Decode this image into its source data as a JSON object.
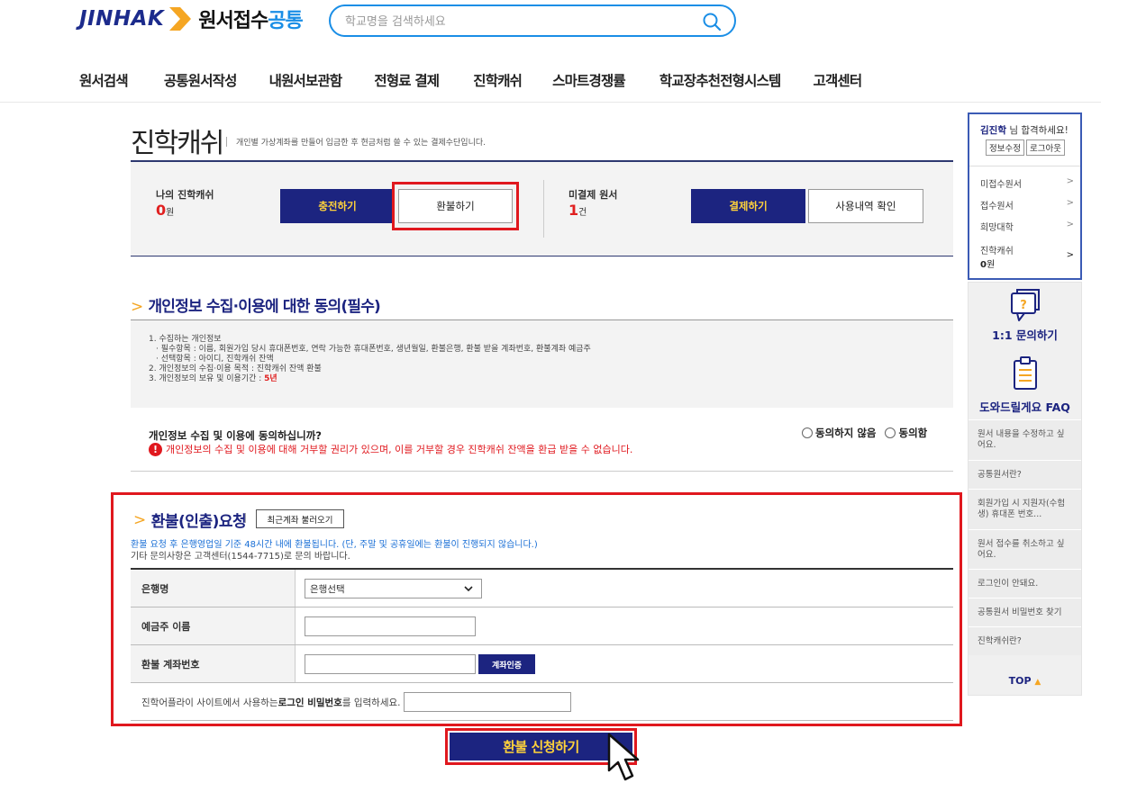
{
  "header": {
    "logo_text": "JINHAK",
    "site_title_main": "원서접수",
    "site_title_accent": "공통",
    "search_placeholder": "학교명을 검색하세요"
  },
  "nav": [
    "원서검색",
    "공통원서작성",
    "내원서보관함",
    "전형료 결제",
    "진학캐쉬",
    "스마트경쟁률",
    "학교장추천전형시스템",
    "고객센터"
  ],
  "page": {
    "title": "진학캐쉬",
    "subtitle": "개인별 가상계좌를 만들어 입금한 후 현금처럼 쓸 수 있는 결제수단입니다."
  },
  "cash_box": {
    "my_cash_label": "나의 진학캐쉬",
    "my_cash_value": "0",
    "my_cash_unit": "원",
    "charge_button": "충전하기",
    "refund_button": "환불하기",
    "unpaid_label": "미결제 원서",
    "unpaid_value": "1",
    "unpaid_unit": "건",
    "pay_button": "결제하기",
    "history_button": "사용내역 확인"
  },
  "privacy": {
    "title": "개인정보 수집·이용에 대한 동의(필수)",
    "lines": [
      "1. 수집하는 개인정보",
      "· 필수항목 : 이름, 회원가입 당시 휴대폰번호, 연락 가능한 휴대폰번호, 생년월일, 환불은행, 환불 받을 계좌번호, 환불계좌 예금주",
      "· 선택항목 : 아이디, 진학캐쉬 잔액",
      "2. 개인정보의 수집·이용 목적 : 진학캐쉬 잔액 환불",
      "3. 개인정보의 보유 및 이용기간 : "
    ],
    "retention": "5년",
    "question": "개인정보 수집 및 이용에 동의하십니까?",
    "warning": "개인정보의 수집 및 이용에 대해 거부할 권리가 있으며, 이를 거부할 경우 진학캐쉬 잔액을 환급 받을 수 없습니다.",
    "option_disagree": "동의하지 않음",
    "option_agree": "동의함"
  },
  "refund": {
    "title": "환불(인출)요청",
    "recent_button": "최근계좌 불러오기",
    "note1": "환불 요청 후 은행영업일 기준 48시간 내에 환불됩니다. (단, 주말 및 공휴일에는 환불이 진행되지 않습니다.)",
    "note2": "기타 문의사항은 고객센터(1544-7715)로 문의 바랍니다.",
    "bank_label": "은행명",
    "bank_select": "은행선택",
    "holder_label": "예금주 이름",
    "account_label": "환불 계좌번호",
    "verify_button": "계좌인증",
    "pw_prefix": "진학어플라이 사이트에서 사용하는 ",
    "pw_bold": "로그인 비밀번호",
    "pw_suffix": "를 입력하세요.",
    "submit_button": "환불 신청하기"
  },
  "sidebar": {
    "user_name": "김진학",
    "greeting": " 님 합격하세요!",
    "edit_button": "정보수정",
    "logout_button": "로그아웃",
    "menu": [
      "미접수원서",
      "접수원서",
      "희망대학"
    ],
    "cash_label": "진학캐쉬",
    "cash_value": "0",
    "cash_unit": "원",
    "qna": "1:1 문의하기",
    "faq_title": "도와드릴게요 FAQ",
    "faq": [
      "원서 내용을 수정하고 싶어요.",
      "공통원서란?",
      "회원가입 시 지원자(수험생) 휴대폰 번호...",
      "원서 접수를 취소하고 싶어요.",
      "로그인이 안돼요.",
      "공통원서 비밀번호 찾기",
      "진학캐쉬란?"
    ],
    "top": "TOP"
  },
  "colors": {
    "navy": "#1c2480",
    "accent_yellow": "#ffd23a",
    "highlight_red": "#e0181e",
    "link_blue": "#1a8ee6"
  }
}
